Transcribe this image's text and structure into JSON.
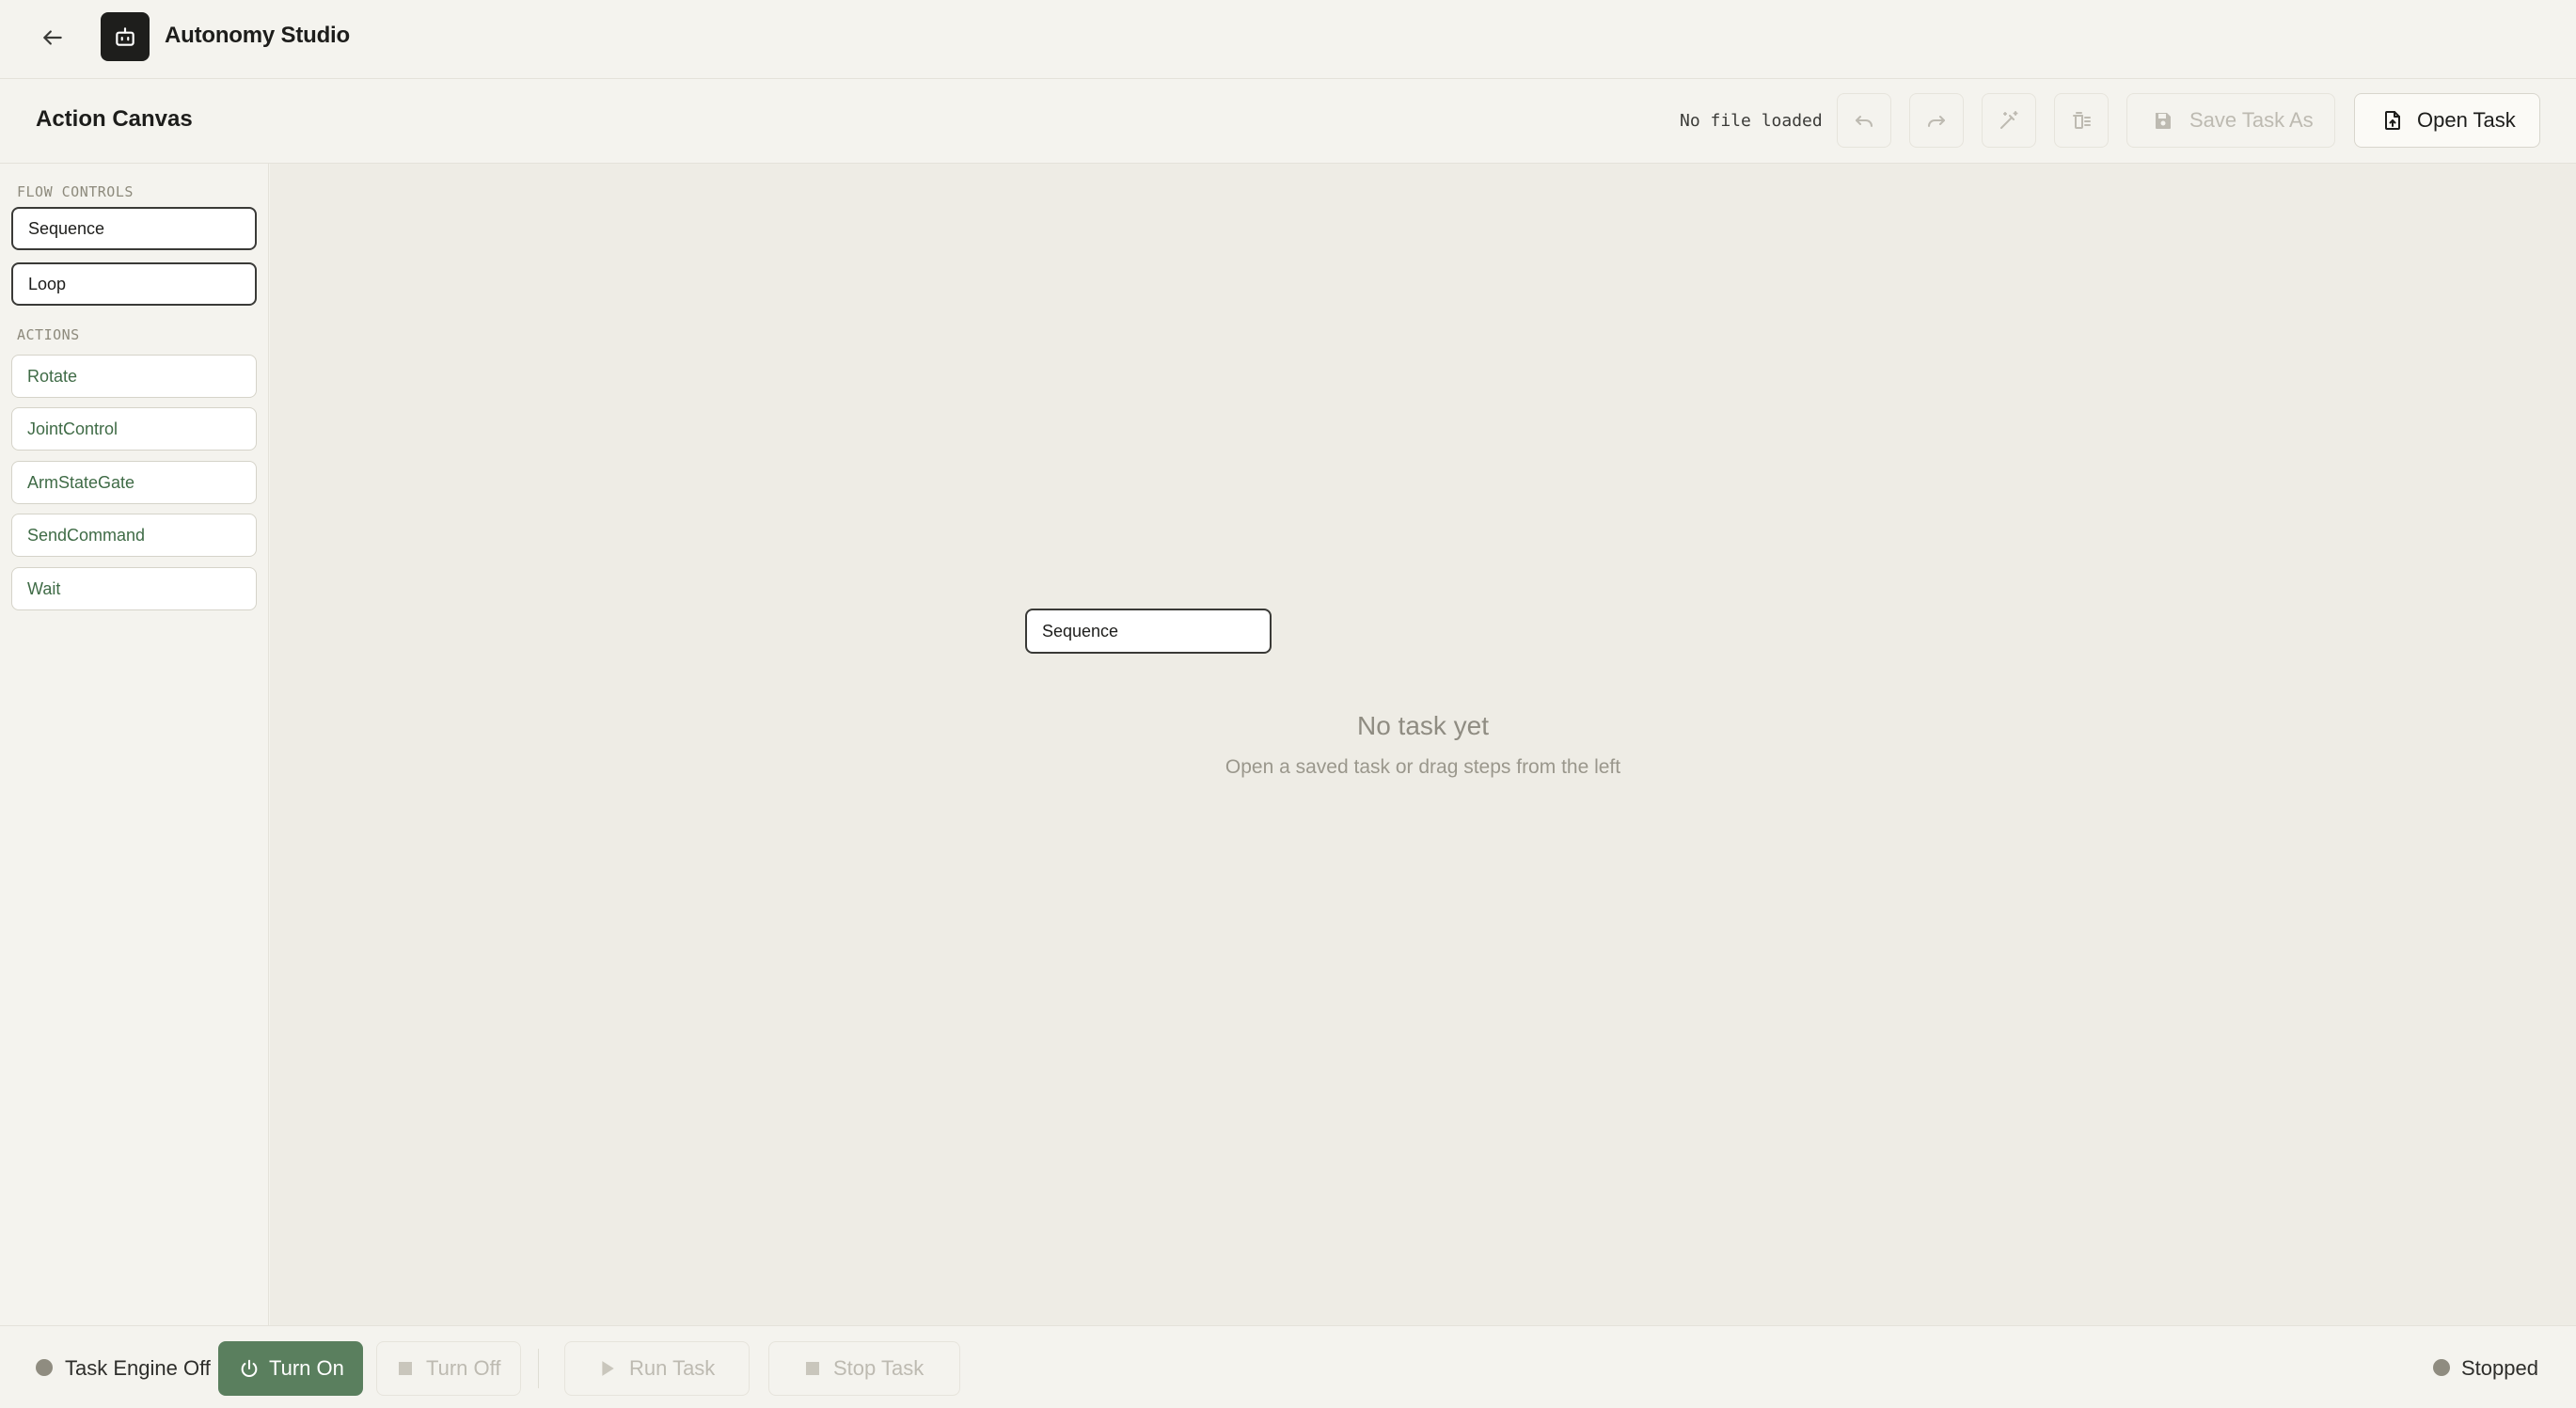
{
  "app": {
    "title": "Autonomy Studio",
    "icons": {
      "back": "arrow-left-icon",
      "logo": "robot-icon"
    }
  },
  "toolbar": {
    "canvas_title": "Action Canvas",
    "file_status": "No file loaded",
    "icon_buttons": [
      "undo-icon",
      "redo-icon",
      "magic-wand-icon",
      "clear-list-icon"
    ],
    "save_as_label": "Save Task As",
    "open_task_label": "Open Task"
  },
  "sidebar": {
    "flow_controls_label": "FLOW CONTROLS",
    "flow_controls": [
      "Sequence",
      "Loop"
    ],
    "actions_label": "ACTIONS",
    "actions": [
      "Rotate",
      "JointControl",
      "ArmStateGate",
      "SendCommand",
      "Wait"
    ]
  },
  "canvas": {
    "node_label": "Sequence",
    "empty_title": "No task yet",
    "empty_subtitle": "Open a saved task or drag steps from the left"
  },
  "bottom": {
    "engine_status": "Task Engine Off",
    "turn_on_label": "Turn On",
    "turn_off_label": "Turn Off",
    "run_task_label": "Run Task",
    "stop_task_label": "Stop Task",
    "run_status": "Stopped"
  },
  "colors": {
    "accent_green": "#5a7f5e",
    "action_text_green": "#3f6b46",
    "status_dot_gray": "#8f8c80",
    "background": "#f3f2ed"
  }
}
